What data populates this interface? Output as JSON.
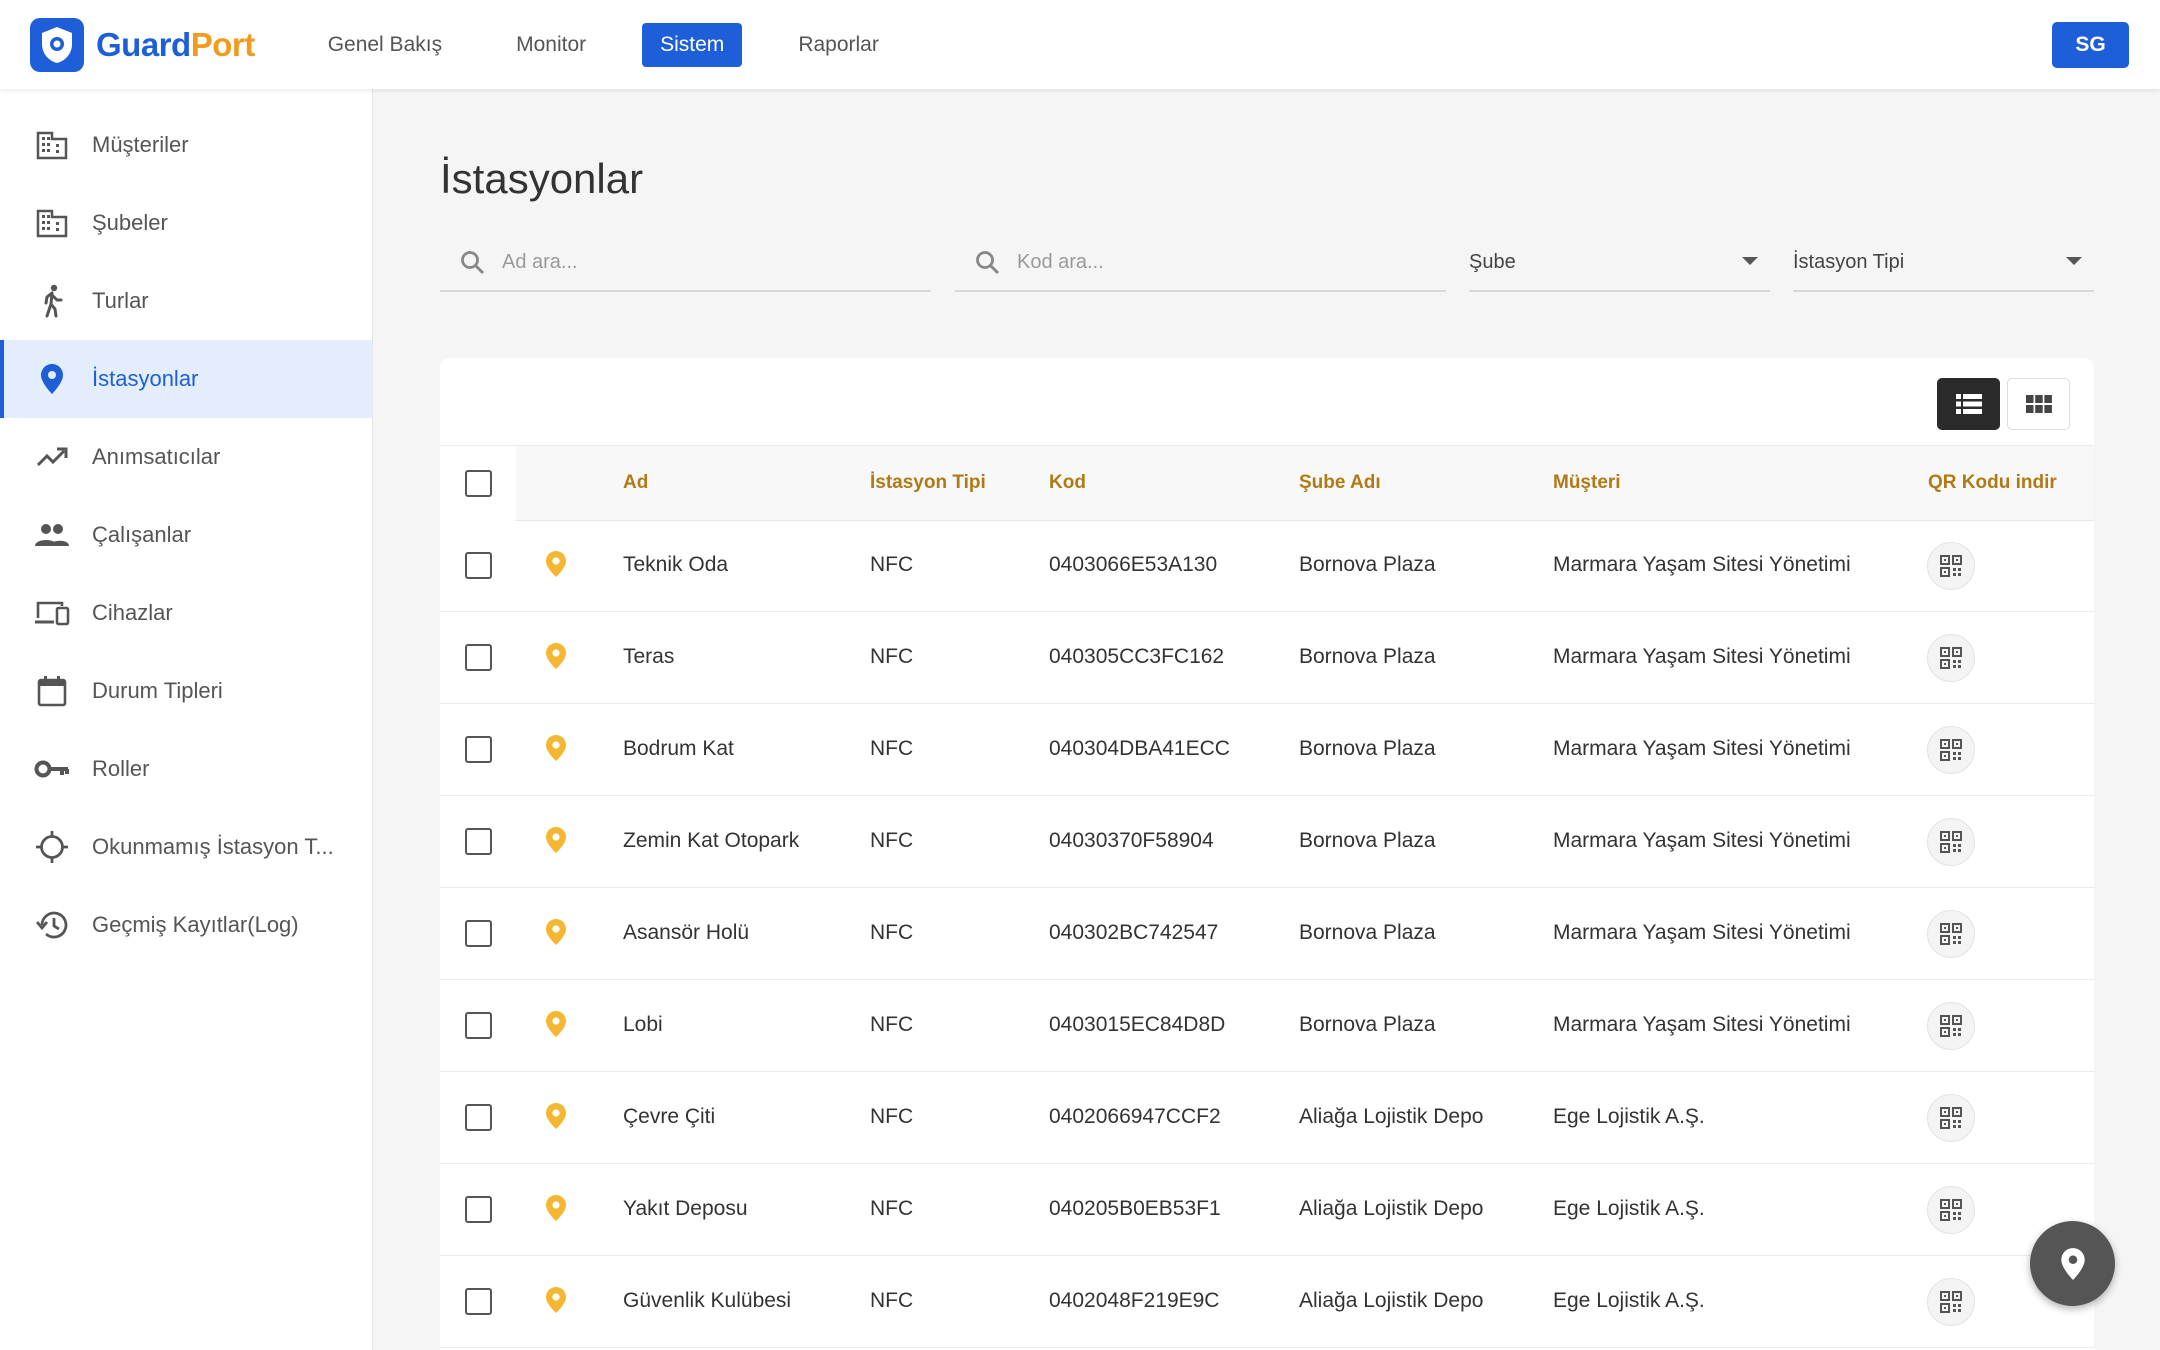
{
  "brand": {
    "name_part1": "Guard",
    "name_part2": "Port",
    "colors": {
      "primary": "#1e5fd9",
      "accent": "#f29a1d"
    }
  },
  "topnav": {
    "items": [
      {
        "label": "Genel Bakış",
        "active": false
      },
      {
        "label": "Monitor",
        "active": false
      },
      {
        "label": "Sistem",
        "active": true
      },
      {
        "label": "Raporlar",
        "active": false
      }
    ],
    "user_initials": "SG"
  },
  "sidebar": {
    "items": [
      {
        "label": "Müşteriler",
        "icon": "building-icon"
      },
      {
        "label": "Şubeler",
        "icon": "building-icon"
      },
      {
        "label": "Turlar",
        "icon": "walk-icon"
      },
      {
        "label": "İstasyonlar",
        "icon": "location-pin-icon",
        "active": true
      },
      {
        "label": "Anımsatıcılar",
        "icon": "trending-up-icon"
      },
      {
        "label": "Çalışanlar",
        "icon": "people-icon"
      },
      {
        "label": "Cihazlar",
        "icon": "devices-icon"
      },
      {
        "label": "Durum Tipleri",
        "icon": "calendar-icon"
      },
      {
        "label": "Roller",
        "icon": "key-icon"
      },
      {
        "label": "Okunmamış İstasyon T...",
        "icon": "crosshair-icon"
      },
      {
        "label": "Geçmiş Kayıtlar(Log)",
        "icon": "history-icon"
      }
    ]
  },
  "main": {
    "title": "İstasyonlar",
    "filters": {
      "name_placeholder": "Ad ara...",
      "code_placeholder": "Kod ara...",
      "branch_select": "Şube",
      "type_select": "İstasyon Tipi"
    },
    "table": {
      "columns": [
        "Ad",
        "İstasyon Tipi",
        "Kod",
        "Şube Adı",
        "Müşteri",
        "QR Kodu indir"
      ],
      "rows": [
        {
          "name": "Teknik Oda",
          "type": "NFC",
          "code": "0403066E53A130",
          "branch": "Bornova Plaza",
          "customer": "Marmara Yaşam Sitesi Yönetimi"
        },
        {
          "name": "Teras",
          "type": "NFC",
          "code": "040305CC3FC162",
          "branch": "Bornova Plaza",
          "customer": "Marmara Yaşam Sitesi Yönetimi"
        },
        {
          "name": "Bodrum Kat",
          "type": "NFC",
          "code": "040304DBA41ECC",
          "branch": "Bornova Plaza",
          "customer": "Marmara Yaşam Sitesi Yönetimi"
        },
        {
          "name": "Zemin Kat Otopark",
          "type": "NFC",
          "code": "04030370F58904",
          "branch": "Bornova Plaza",
          "customer": "Marmara Yaşam Sitesi Yönetimi"
        },
        {
          "name": "Asansör Holü",
          "type": "NFC",
          "code": "040302BC742547",
          "branch": "Bornova Plaza",
          "customer": "Marmara Yaşam Sitesi Yönetimi"
        },
        {
          "name": "Lobi",
          "type": "NFC",
          "code": "0403015EC84D8D",
          "branch": "Bornova Plaza",
          "customer": "Marmara Yaşam Sitesi Yönetimi"
        },
        {
          "name": "Çevre Çiti",
          "type": "NFC",
          "code": "0402066947CCF2",
          "branch": "Aliağa Lojistik Depo",
          "customer": "Ege Lojistik A.Ş."
        },
        {
          "name": "Yakıt Deposu",
          "type": "NFC",
          "code": "040205B0EB53F1",
          "branch": "Aliağa Lojistik Depo",
          "customer": "Ege Lojistik A.Ş."
        },
        {
          "name": "Güvenlik Kulübesi",
          "type": "NFC",
          "code": "0402048F219E9C",
          "branch": "Aliağa Lojistik Depo",
          "customer": "Ege Lojistik A.Ş."
        }
      ]
    }
  }
}
